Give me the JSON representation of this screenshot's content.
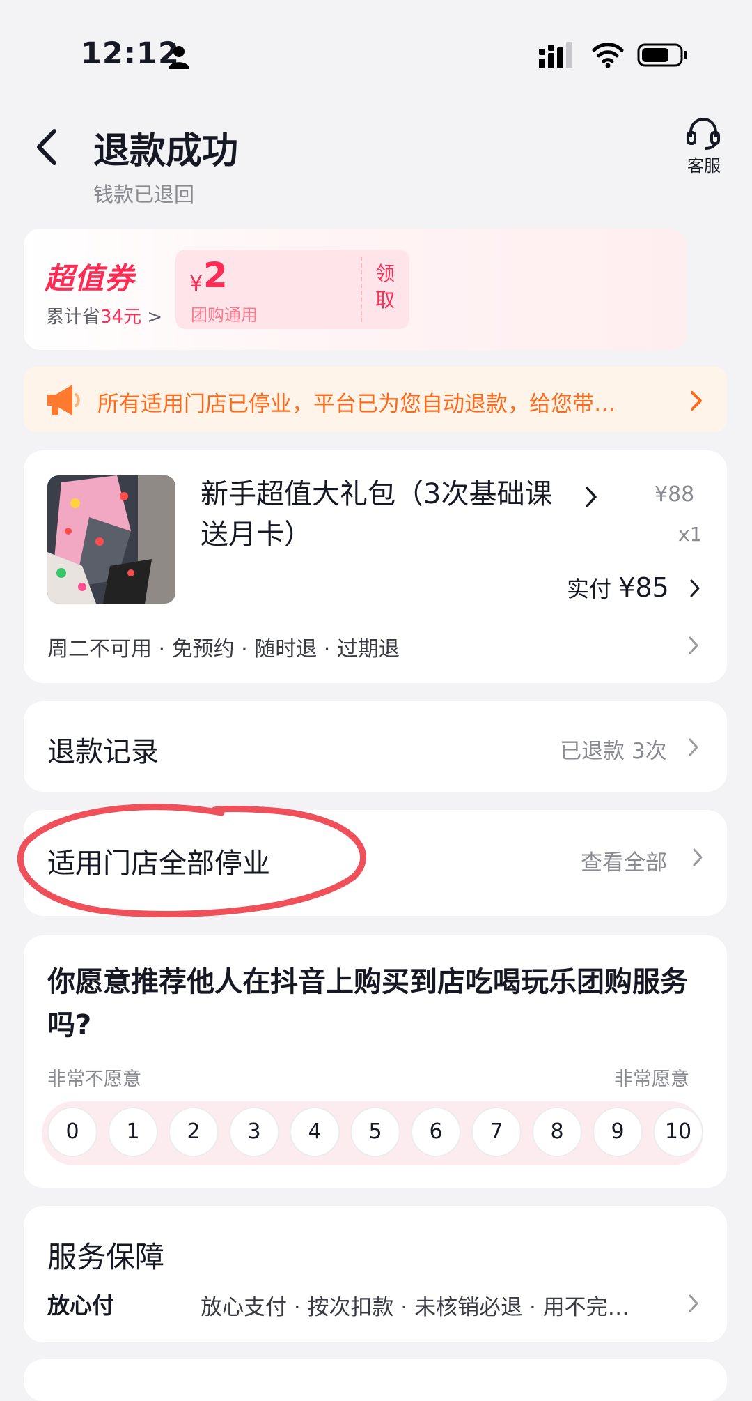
{
  "status_bar": {
    "time": "12:12"
  },
  "header": {
    "title": "退款成功",
    "subtitle": "钱款已退回",
    "service_label": "客服"
  },
  "coupon_banner": {
    "title": "超值券",
    "savings_prefix": "累计省",
    "savings_amount": "34元",
    "savings_suffix": " >",
    "coupon_currency": "¥",
    "coupon_amount": "2",
    "coupon_desc": "团购通用",
    "claim_label": "领取"
  },
  "notice": {
    "text": "所有适用门店已停业，平台已为您自动退款，给您带…"
  },
  "product": {
    "name": "新手超值大礼包（3次基础课送月卡）",
    "price": "¥88",
    "quantity": "x1",
    "paid_label": "实付",
    "paid_amount": "¥85",
    "tags": "周二不可用 · 免预约 · 随时退 · 过期退"
  },
  "refund_record": {
    "title": "退款记录",
    "status": "已退款 3次"
  },
  "store_status": {
    "title": "适用门店全部停业",
    "action": "查看全部"
  },
  "survey": {
    "question": "你愿意推荐他人在抖音上购买到店吃喝玩乐团购服务吗?",
    "low_label": "非常不愿意",
    "high_label": "非常愿意",
    "scale": [
      "0",
      "1",
      "2",
      "3",
      "4",
      "5",
      "6",
      "7",
      "8",
      "9",
      "10"
    ]
  },
  "guarantee": {
    "title": "服务保障",
    "label": "放心付",
    "desc": "放心支付 · 按次扣款 · 未核销必退 · 用不完…"
  },
  "colors": {
    "brand_red": "#fe2c55",
    "notice_orange": "#ff6a1a",
    "annotation_circle": "#f0505a"
  }
}
